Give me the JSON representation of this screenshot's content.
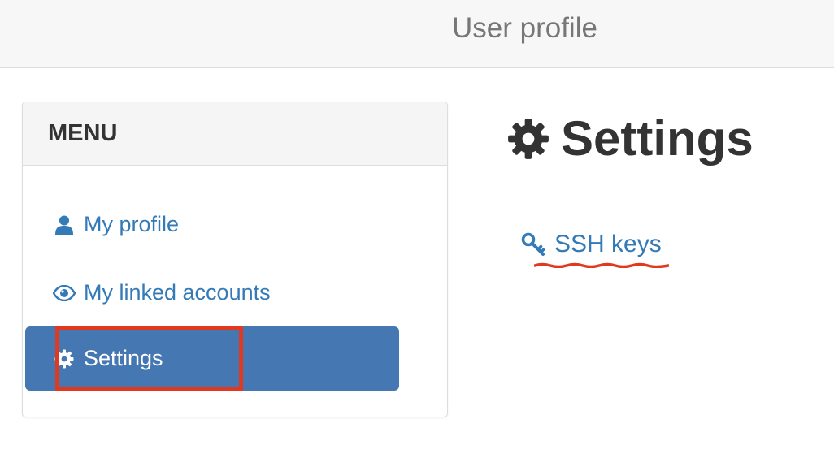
{
  "header": {
    "title": "User profile"
  },
  "menu": {
    "heading": "MENU",
    "items": [
      {
        "label": "My profile",
        "icon": "user-icon",
        "active": false
      },
      {
        "label": "My linked accounts",
        "icon": "eye-icon",
        "active": false
      },
      {
        "label": "Settings",
        "icon": "gear-icon",
        "active": true
      }
    ]
  },
  "main": {
    "title": "Settings",
    "title_icon": "gear-icon",
    "links": [
      {
        "label": "SSH keys",
        "icon": "key-icon"
      }
    ]
  },
  "colors": {
    "link": "#337ab7",
    "active_bg": "#4577b3",
    "annotation": "#e0391f"
  }
}
